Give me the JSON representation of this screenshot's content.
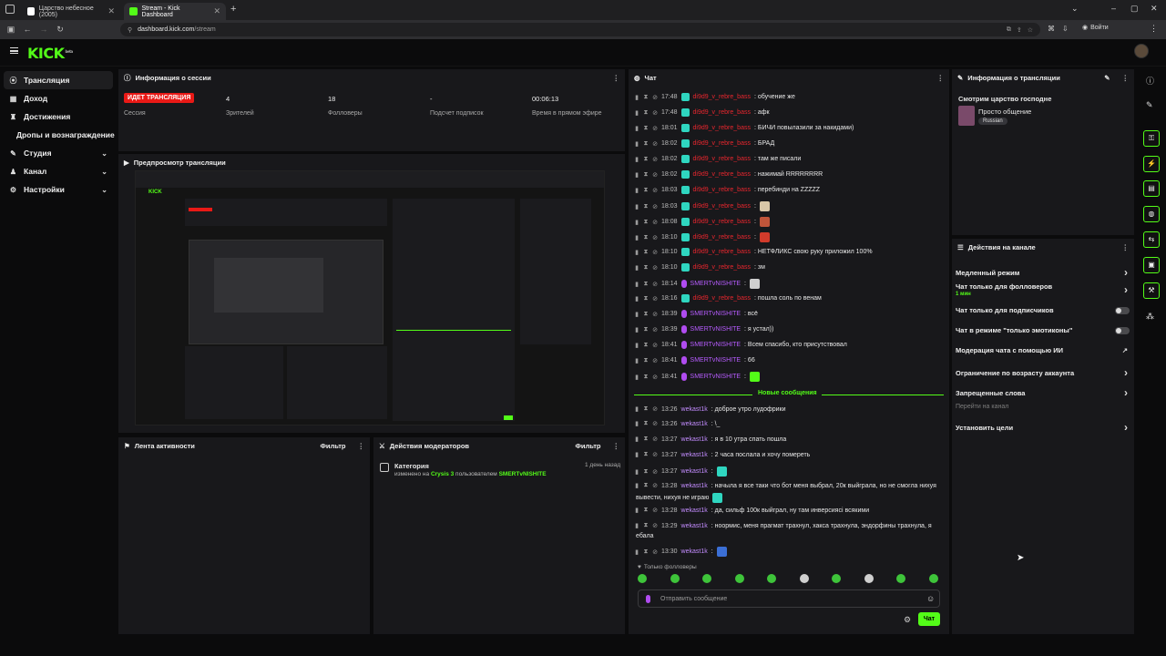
{
  "browser": {
    "tabs": [
      {
        "title": "Царство небесное (2005)",
        "active": false
      },
      {
        "title": "Stream - Kick Dashboard",
        "active": true
      }
    ],
    "url_host": "dashboard.kick.com",
    "url_path": "/stream",
    "profile_label": "Войти"
  },
  "app": {
    "logo": "KICK",
    "logo_tag": "beta"
  },
  "sidebar": {
    "items": [
      {
        "label": "Трансляция",
        "icon": "broadcast-icon",
        "active": true
      },
      {
        "label": "Доход",
        "icon": "wallet-icon"
      },
      {
        "label": "Достижения",
        "icon": "trophy-icon"
      },
      {
        "label": "Дропы и вознаграждение",
        "icon": ""
      },
      {
        "label": "Студия",
        "icon": "studio-icon",
        "chevron": true
      },
      {
        "label": "Канал",
        "icon": "channel-icon",
        "chevron": true
      },
      {
        "label": "Настройки",
        "icon": "gear-icon",
        "chevron": true
      }
    ]
  },
  "session": {
    "title": "Информация о сессии",
    "live_badge": "ИДЕТ ТРАНСЛЯЦИЯ",
    "session_label": "Сессия",
    "viewers": "4",
    "viewers_label": "Зрителей",
    "followers": "18",
    "followers_label": "Фолловеры",
    "subs": "-",
    "subs_label": "Подсчет подписок",
    "uptime": "00:06:13",
    "uptime_label": "Время в прямом эфире"
  },
  "preview": {
    "title": "Предпросмотр трансляции"
  },
  "activity": {
    "title": "Лента активности",
    "filter": "Фильтр"
  },
  "modactions": {
    "title": "Действия модераторов",
    "filter": "Фильтр",
    "entry_title": "Категория",
    "entry_time": "1 день назад",
    "entry_prefix": "изменено на",
    "entry_category": "Crysis 3",
    "entry_mid": "пользователем",
    "entry_user": "SMERTvNISHITE"
  },
  "chat": {
    "title": "Чат",
    "messages": [
      {
        "time": "17:48",
        "user": "di9d9_v_rebre_bass",
        "cls": "u1",
        "badge": "teal",
        "text": ": обучение же"
      },
      {
        "time": "17:48",
        "user": "di9d9_v_rebre_bass",
        "cls": "u1",
        "badge": "teal",
        "text": ": афк"
      },
      {
        "time": "18:01",
        "user": "di9d9_v_rebre_bass",
        "cls": "u1",
        "badge": "teal",
        "text": ": БИЧИ повылазили за накидами)"
      },
      {
        "time": "18:02",
        "user": "di9d9_v_rebre_bass",
        "cls": "u1",
        "badge": "teal",
        "text": ": БРАД"
      },
      {
        "time": "18:02",
        "user": "di9d9_v_rebre_bass",
        "cls": "u1",
        "badge": "teal",
        "text": ": там же писали"
      },
      {
        "time": "18:02",
        "user": "di9d9_v_rebre_bass",
        "cls": "u1",
        "badge": "teal",
        "text": ": нажимай RRRRRRRR"
      },
      {
        "time": "18:03",
        "user": "di9d9_v_rebre_bass",
        "cls": "u1",
        "badge": "teal",
        "text": ": перебинди на ZZZZZ"
      },
      {
        "time": "18:03",
        "user": "di9d9_v_rebre_bass",
        "cls": "u1",
        "badge": "teal",
        "text": ":",
        "emote": "#d9c7a8"
      },
      {
        "time": "18:08",
        "user": "di9d9_v_rebre_bass",
        "cls": "u1",
        "badge": "teal",
        "text": ":",
        "emote": "#c0553a"
      },
      {
        "time": "18:10",
        "user": "di9d9_v_rebre_bass",
        "cls": "u1",
        "badge": "teal",
        "text": ":",
        "emote": "#d23b2b"
      },
      {
        "time": "18:10",
        "user": "di9d9_v_rebre_bass",
        "cls": "u1",
        "badge": "teal",
        "text": ": НЕТФЛИКС свою руку приложил 100%"
      },
      {
        "time": "18:10",
        "user": "di9d9_v_rebre_bass",
        "cls": "u1",
        "badge": "teal",
        "text": ": зм"
      },
      {
        "time": "18:14",
        "user": "SMERTvNISHITE",
        "cls": "u2",
        "badge": "mic",
        "text": ":",
        "emote": "#cfcfcf"
      },
      {
        "time": "18:16",
        "user": "di9d9_v_rebre_bass",
        "cls": "u1",
        "badge": "teal",
        "text": ": пошла соль по венам"
      },
      {
        "time": "18:39",
        "user": "SMERTvNISHITE",
        "cls": "u2",
        "badge": "mic",
        "text": ": всё"
      },
      {
        "time": "18:39",
        "user": "SMERTvNISHITE",
        "cls": "u2",
        "badge": "mic",
        "text": ": я устал))"
      },
      {
        "time": "18:41",
        "user": "SMERTvNISHITE",
        "cls": "u2",
        "badge": "mic",
        "text": ": Всем спасибо, кто присутствовал"
      },
      {
        "time": "18:41",
        "user": "SMERTvNISHITE",
        "cls": "u2",
        "badge": "mic",
        "text": ": 66"
      },
      {
        "time": "18:41",
        "user": "SMERTvNISHITE",
        "cls": "u2",
        "badge": "mic",
        "text": ":",
        "emote": "#53fc18"
      }
    ],
    "new_messages_label": "Новые сообщения",
    "new_messages": [
      {
        "time": "13:26",
        "user": "wekast1k",
        "text": ": доброе утро лудофрики"
      },
      {
        "time": "13:26",
        "user": "wekast1k",
        "text": ": \\_"
      },
      {
        "time": "13:27",
        "user": "wekast1k",
        "text": ": я в 10 утра спать пошла"
      },
      {
        "time": "13:27",
        "user": "wekast1k",
        "text": ": 2 часа послала и хочу помереть"
      },
      {
        "time": "13:27",
        "user": "wekast1k",
        "text": ":",
        "emote": "#2fd6c0"
      },
      {
        "time": "13:28",
        "user": "wekast1k",
        "text": ": начыла я все таки что бот меня выбрал, 20к выйграла, но не смогла нихуя",
        "cont": "вывести, нихуя не играю",
        "emote2": "#2fd6c0"
      },
      {
        "time": "13:28",
        "user": "wekast1k",
        "text": ": да, сильф 100к выйграл, ну там инверсиясi всякими"
      },
      {
        "time": "13:29",
        "user": "wekast1k",
        "text": ": ноормис, меня прагмат трахнул, хакса трахнула, эндорфины трахнула, я",
        "cont": "ебала"
      },
      {
        "time": "13:30",
        "user": "wekast1k",
        "text": ":",
        "emote": "#3b6fd6"
      }
    ],
    "followers_only_label": "Только фолловеры",
    "input_placeholder": "Отправить сообщение",
    "send_label": "Чат"
  },
  "stream_info": {
    "title": "Информация о трансляции",
    "stream_title": "Смотрим царство господне",
    "category": "Просто общение",
    "language_tag": "Russian"
  },
  "channel_actions": {
    "title": "Действия на канале",
    "items": [
      {
        "label": "Медленный режим",
        "control": "arrow"
      },
      {
        "label": "Чат только для фолловеров",
        "sub": "1 мин",
        "control": "arrow"
      },
      {
        "label": "Чат только для подписчиков",
        "control": "toggle"
      },
      {
        "label": "Чат в режиме \"только эмотиконы\"",
        "control": "toggle"
      },
      {
        "label": "Модерация чата с помощью ИИ",
        "control": "external"
      },
      {
        "label": "Ограничение по возрасту аккаунта",
        "control": "arrow"
      },
      {
        "label": "Запрещенные слова",
        "control": "arrow"
      },
      {
        "label": "Перейти на канал",
        "control": "none",
        "muted": true
      },
      {
        "label": "Установить цели",
        "control": "arrow"
      }
    ]
  },
  "colors": {
    "accent": "#53fc18",
    "live": "#e91916",
    "panel": "#18181b"
  }
}
